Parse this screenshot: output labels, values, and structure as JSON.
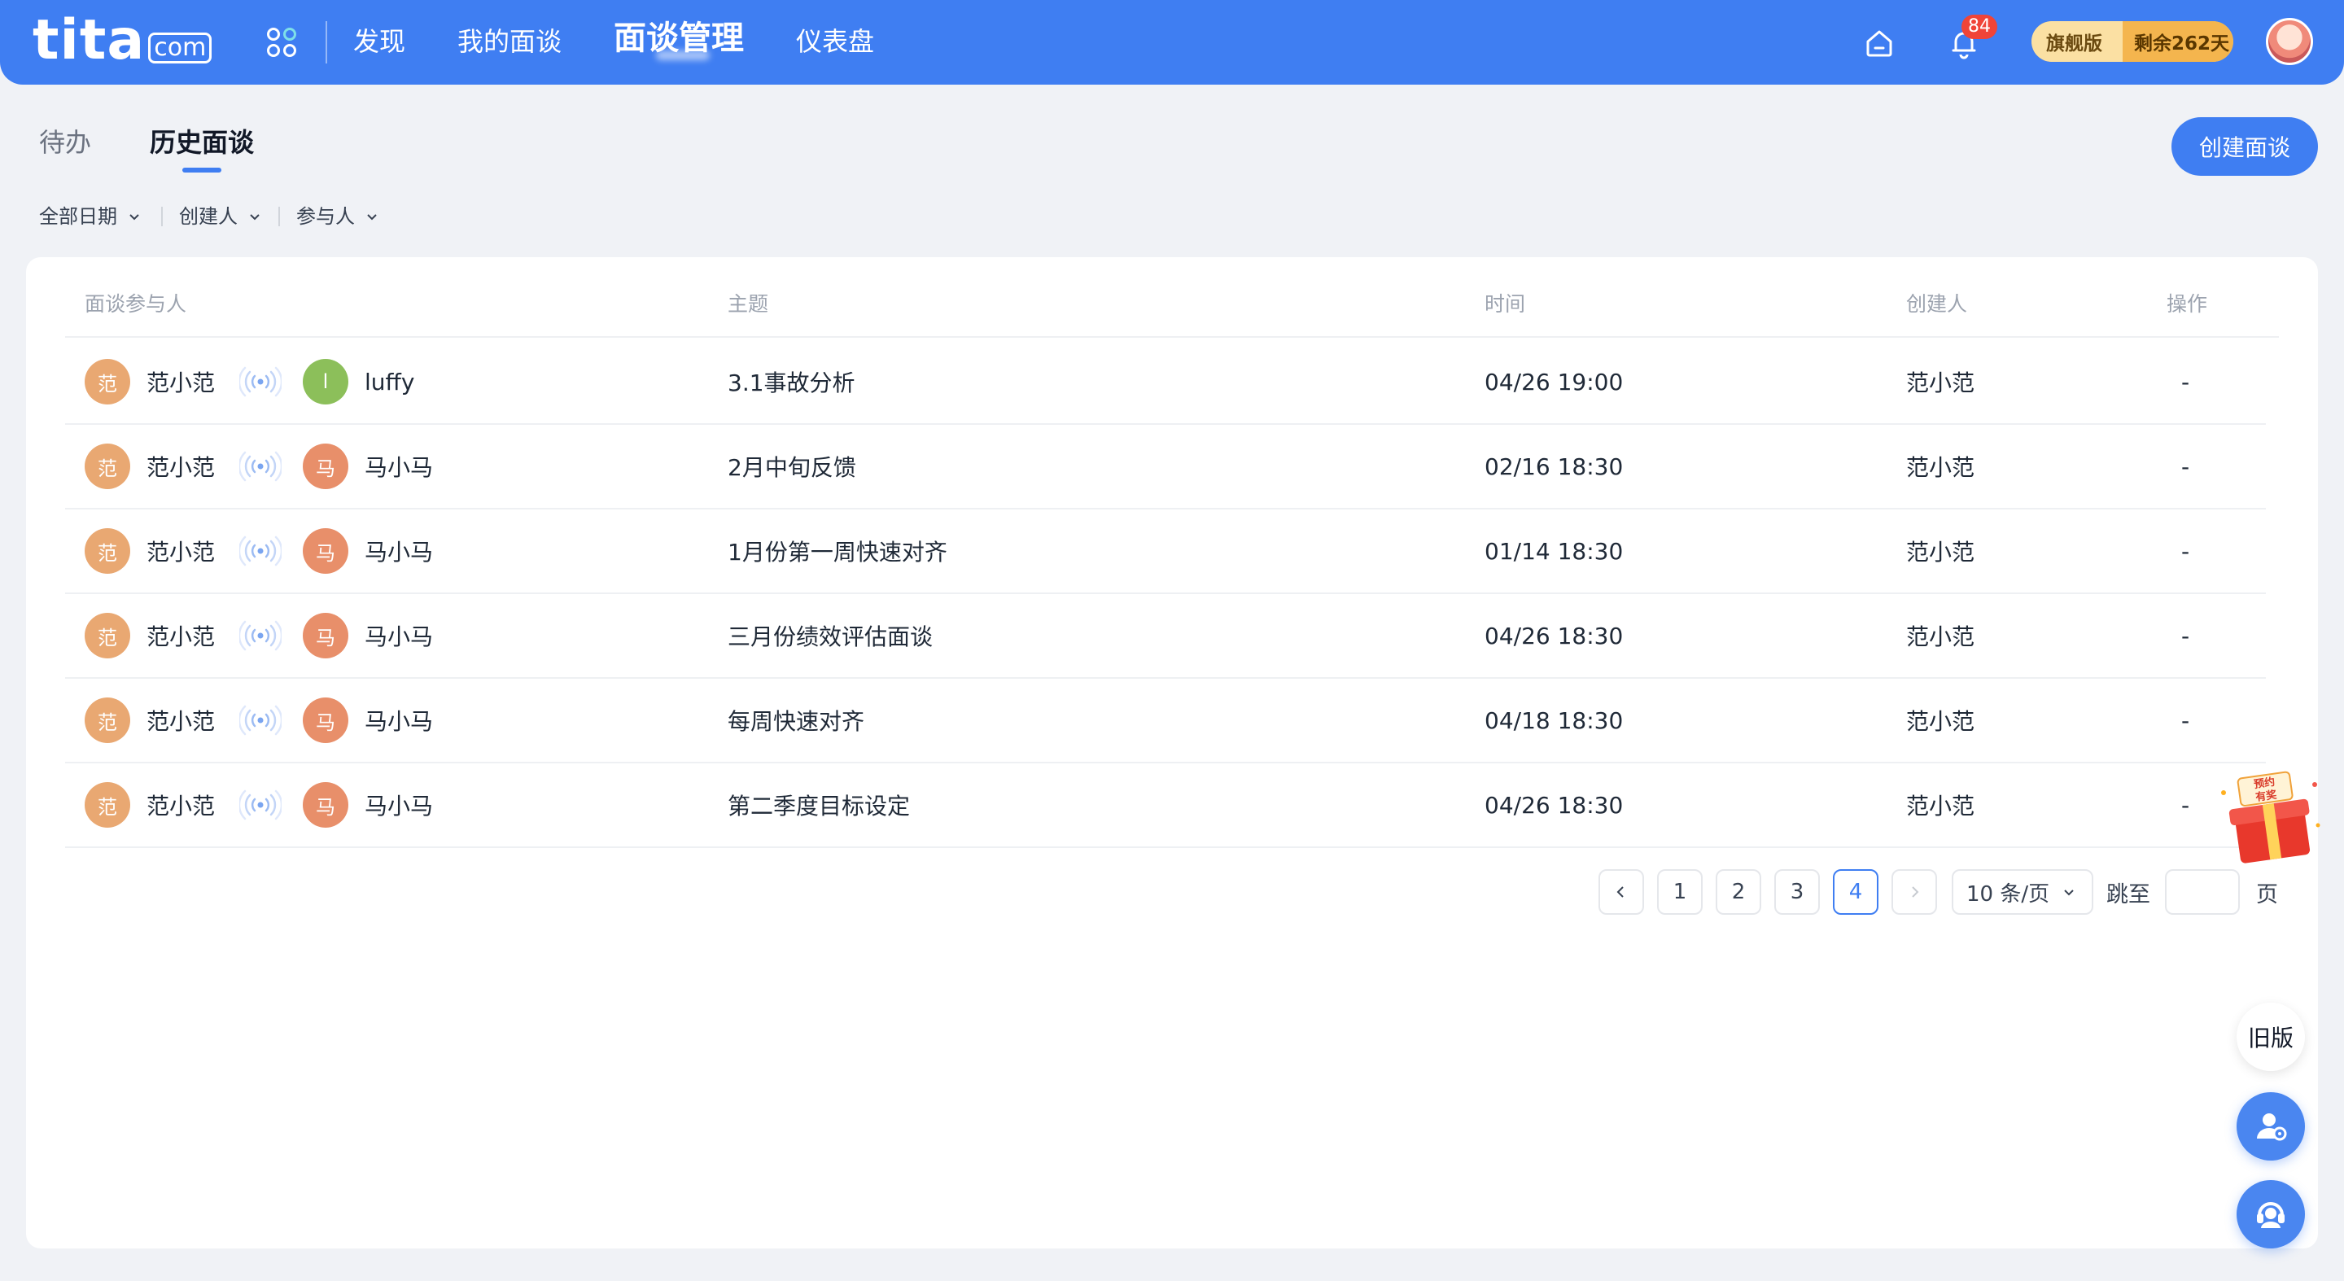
{
  "app": {
    "logo_main": "tita",
    "logo_sub": "com",
    "nav": [
      {
        "label": "发现"
      },
      {
        "label": "我的面谈"
      },
      {
        "label": "面谈管理"
      },
      {
        "label": "仪表盘"
      }
    ],
    "notification_count": "84",
    "edition_label": "旗舰版",
    "edition_remaining": "剩余262天"
  },
  "tabs": [
    {
      "label": "待办"
    },
    {
      "label": "历史面谈"
    }
  ],
  "create_button": "创建面谈",
  "filters": [
    {
      "label": "全部日期"
    },
    {
      "label": "创建人"
    },
    {
      "label": "参与人"
    }
  ],
  "table": {
    "columns": {
      "participants": "面谈参与人",
      "topic": "主题",
      "time": "时间",
      "creator": "创建人",
      "actions": "操作"
    },
    "rows": [
      {
        "p1": "范小范",
        "p1_initial": "范",
        "p2": "luffy",
        "p2_initial": "l",
        "topic": "3.1事故分析",
        "time": "04/26 19:00",
        "creator": "范小范",
        "action": "-"
      },
      {
        "p1": "范小范",
        "p1_initial": "范",
        "p2": "马小马",
        "p2_initial": "马",
        "topic": "2月中旬反馈",
        "time": "02/16 18:30",
        "creator": "范小范",
        "action": "-"
      },
      {
        "p1": "范小范",
        "p1_initial": "范",
        "p2": "马小马",
        "p2_initial": "马",
        "topic": "1月份第一周快速对齐",
        "time": "01/14 18:30",
        "creator": "范小范",
        "action": "-"
      },
      {
        "p1": "范小范",
        "p1_initial": "范",
        "p2": "马小马",
        "p2_initial": "马",
        "topic": "三月份绩效评估面谈",
        "time": "04/26 18:30",
        "creator": "范小范",
        "action": "-"
      },
      {
        "p1": "范小范",
        "p1_initial": "范",
        "p2": "马小马",
        "p2_initial": "马",
        "topic": "每周快速对齐",
        "time": "04/18 18:30",
        "creator": "范小范",
        "action": "-"
      },
      {
        "p1": "范小范",
        "p1_initial": "范",
        "p2": "马小马",
        "p2_initial": "马",
        "topic": "第二季度目标设定",
        "time": "04/26 18:30",
        "creator": "范小范",
        "action": "-"
      }
    ]
  },
  "pagination": {
    "pages": [
      "1",
      "2",
      "3",
      "4"
    ],
    "current": "4",
    "page_size": "10 条/页",
    "jump_label": "跳至",
    "jump_value": "",
    "page_suffix": "页"
  },
  "floating": {
    "old_version": "旧版",
    "gift_text_1": "预约",
    "gift_text_2": "有奖"
  },
  "colors": {
    "brand": "#3f7ef2",
    "badge": "#f04438",
    "avatar_orange": "#e9a872",
    "avatar_green": "#8cbf5a"
  }
}
